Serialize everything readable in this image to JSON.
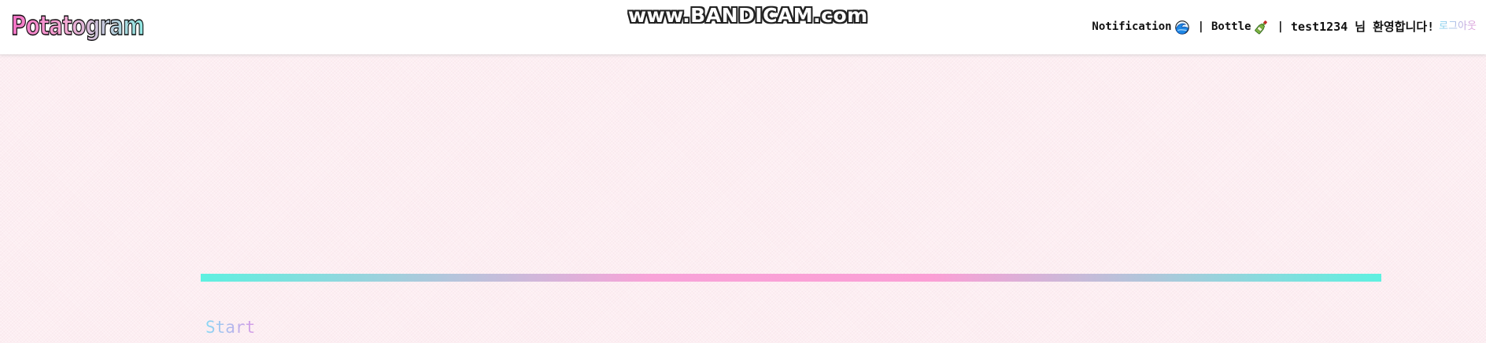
{
  "header": {
    "logo_text": "Potatogram",
    "watermark": "www.BANDICAM.com",
    "nav": {
      "notification_label": "Notification",
      "notification_icon": "wave-icon",
      "separator": "|",
      "bottle_label": "Bottle",
      "bottle_icon": "bottle-icon",
      "welcome": "test1234 님 환영합니다!",
      "logout_label": "로그아웃"
    }
  },
  "main": {
    "progress": {
      "value": 1.0
    },
    "start_label": "Start"
  },
  "colors": {
    "page_background": "#fdeef2",
    "header_background": "#ffffff",
    "progress_gradient_start": "#5ef0e0",
    "progress_gradient_mid": "#fb9fd5",
    "start_gradient_start": "#8ad8f4",
    "start_gradient_end": "#d79be6"
  }
}
